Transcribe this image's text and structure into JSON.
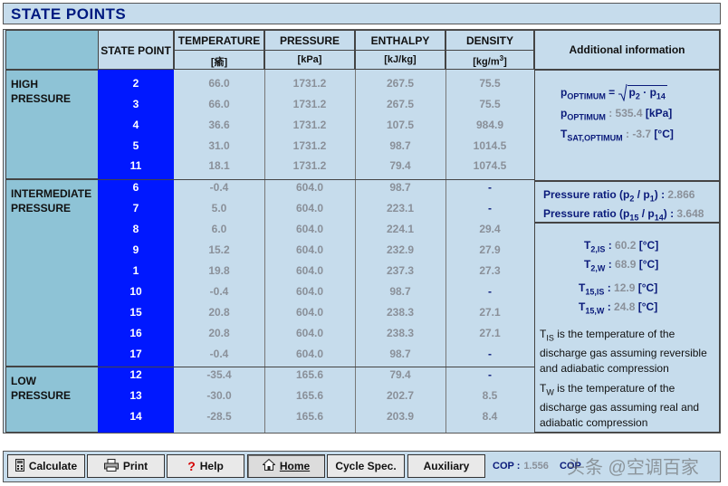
{
  "title": "STATE POINTS",
  "headers": {
    "state_point": "STATE POINT",
    "temperature": "TEMPERATURE",
    "temperature_unit": "[瘉]",
    "pressure": "PRESSURE",
    "pressure_unit": "[kPa]",
    "enthalpy": "ENTHALPY",
    "enthalpy_unit": "[kJ/kg]",
    "density": "DENSITY",
    "density_unit": "[kg/m",
    "density_unit_sup": "3",
    "density_unit_end": "]",
    "additional": "Additional information"
  },
  "groups": {
    "high": "HIGH PRESSURE",
    "intermediate_1": "INTERMEDIATE",
    "intermediate_2": "PRESSURE",
    "low": "LOW PRESSURE"
  },
  "rows": [
    {
      "sp": "2",
      "t": "66.0",
      "p": "1731.2",
      "h": "267.5",
      "d": "75.5"
    },
    {
      "sp": "3",
      "t": "66.0",
      "p": "1731.2",
      "h": "267.5",
      "d": "75.5"
    },
    {
      "sp": "4",
      "t": "36.6",
      "p": "1731.2",
      "h": "107.5",
      "d": "984.9"
    },
    {
      "sp": "5",
      "t": "31.0",
      "p": "1731.2",
      "h": "98.7",
      "d": "1014.5"
    },
    {
      "sp": "11",
      "t": "18.1",
      "p": "1731.2",
      "h": "79.4",
      "d": "1074.5"
    },
    {
      "sp": "6",
      "t": "-0.4",
      "p": "604.0",
      "h": "98.7",
      "d": "-"
    },
    {
      "sp": "7",
      "t": "5.0",
      "p": "604.0",
      "h": "223.1",
      "d": "-"
    },
    {
      "sp": "8",
      "t": "6.0",
      "p": "604.0",
      "h": "224.1",
      "d": "29.4"
    },
    {
      "sp": "9",
      "t": "15.2",
      "p": "604.0",
      "h": "232.9",
      "d": "27.9"
    },
    {
      "sp": "1",
      "t": "19.8",
      "p": "604.0",
      "h": "237.3",
      "d": "27.3"
    },
    {
      "sp": "10",
      "t": "-0.4",
      "p": "604.0",
      "h": "98.7",
      "d": "-"
    },
    {
      "sp": "15",
      "t": "20.8",
      "p": "604.0",
      "h": "238.3",
      "d": "27.1"
    },
    {
      "sp": "16",
      "t": "20.8",
      "p": "604.0",
      "h": "238.3",
      "d": "27.1"
    },
    {
      "sp": "17",
      "t": "-0.4",
      "p": "604.0",
      "h": "98.7",
      "d": "-"
    },
    {
      "sp": "12",
      "t": "-35.4",
      "p": "165.6",
      "h": "79.4",
      "d": "-"
    },
    {
      "sp": "13",
      "t": "-30.0",
      "p": "165.6",
      "h": "202.7",
      "d": "8.5"
    },
    {
      "sp": "14",
      "t": "-28.5",
      "p": "165.6",
      "h": "203.9",
      "d": "8.4"
    }
  ],
  "info": {
    "p_opt_sym": "p",
    "p_opt_sub": "OPTIMUM",
    "eq": " = ",
    "sqrt_inner_a": "p",
    "sqrt_inner_a_sub": "2",
    "sqrt_dot": " · ",
    "sqrt_inner_b": "p",
    "sqrt_inner_b_sub": "14",
    "p_opt_value": "535.4",
    "p_opt_unit": "[kPa]",
    "t_sat_sym": "T",
    "t_sat_sub": "SAT,OPTIMUM",
    "t_sat_value": "-3.7",
    "t_sat_unit": "[°C]",
    "ratio1_label": "Pressure ratio (p",
    "ratio1_sub_a": "2",
    "ratio1_mid": " / p",
    "ratio1_sub_b": "1",
    "ratio1_end": ") :",
    "ratio1_value": "2.866",
    "ratio2_label": "Pressure ratio (p",
    "ratio2_sub_a": "15",
    "ratio2_mid": " / p",
    "ratio2_sub_b": "14",
    "ratio2_end": ") :",
    "ratio2_value": "3.648",
    "t2is_sub": "2,IS",
    "t2is_value": "60.2",
    "t2w_sub": "2,W",
    "t2w_value": "68.9",
    "t15is_sub": "15,IS",
    "t15is_value": "12.9",
    "t15w_sub": "15,W",
    "t15w_value": "24.8",
    "unit_c": "[°C]",
    "t_sym": "T",
    "colon": " :",
    "note1_sub": "IS",
    "note1_text": " is the temperature of the discharge gas assuming reversible and adiabatic compression",
    "note2_sub": "W",
    "note2_text": " is the temperature of the discharge gas assuming real and adiabatic compression"
  },
  "toolbar": {
    "calculate": "Calculate",
    "print": "Print",
    "help": "Help",
    "home": "Home",
    "cycle_spec": "Cycle Spec.",
    "auxiliary": "Auxiliary",
    "cop_label": "COP :",
    "cop_value": "1.556",
    "cop2_label": "COP"
  },
  "watermark": "头条 @空调百家"
}
